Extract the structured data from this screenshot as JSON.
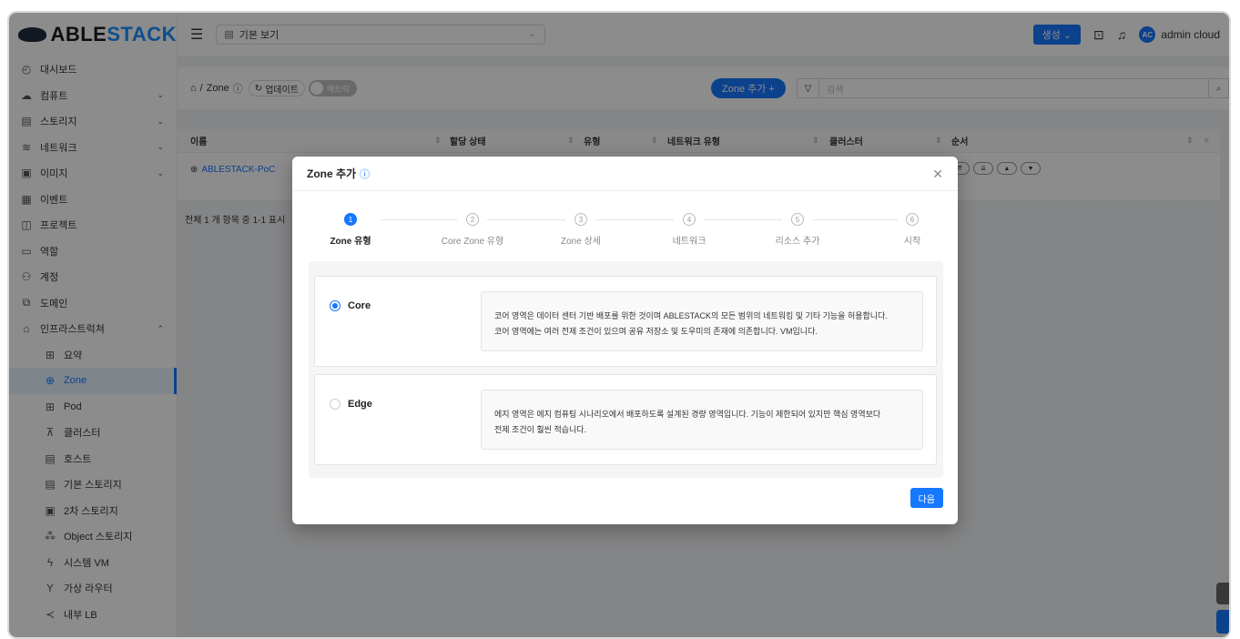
{
  "app": {
    "logo_text_a": "ABLE",
    "logo_text_b": "STACK",
    "accent": "#1677ff"
  },
  "sidebar": {
    "items": [
      {
        "label": "대시보드",
        "icon": "dashboard-icon"
      },
      {
        "label": "컴퓨트",
        "icon": "cloud-icon",
        "expandable": true
      },
      {
        "label": "스토리지",
        "icon": "storage-icon",
        "expandable": true
      },
      {
        "label": "네트워크",
        "icon": "wifi-icon",
        "expandable": true
      },
      {
        "label": "이미지",
        "icon": "image-icon",
        "expandable": true
      },
      {
        "label": "이벤트",
        "icon": "calendar-icon"
      },
      {
        "label": "프로젝트",
        "icon": "project-icon"
      },
      {
        "label": "역할",
        "icon": "idcard-icon"
      },
      {
        "label": "계정",
        "icon": "team-icon"
      },
      {
        "label": "도메인",
        "icon": "domain-icon"
      },
      {
        "label": "인프라스트럭쳐",
        "icon": "bank-icon",
        "expanded": true
      }
    ],
    "sub_items": [
      {
        "label": "요약",
        "icon": "summary-icon"
      },
      {
        "label": "Zone",
        "icon": "globe-icon",
        "active": true
      },
      {
        "label": "Pod",
        "icon": "appstore-icon"
      },
      {
        "label": "클러스터",
        "icon": "cluster-icon"
      },
      {
        "label": "호스트",
        "icon": "host-icon"
      },
      {
        "label": "기본 스토리지",
        "icon": "database-icon"
      },
      {
        "label": "2차 스토리지",
        "icon": "image-icon"
      },
      {
        "label": "Object 스토리지",
        "icon": "object-icon"
      },
      {
        "label": "시스템 VM",
        "icon": "thunder-icon"
      },
      {
        "label": "가상 라우터",
        "icon": "fork-icon"
      },
      {
        "label": "내부 LB",
        "icon": "share-icon"
      }
    ]
  },
  "header": {
    "view_select": "기본 보기",
    "create_label": "생성",
    "user_initials": "AC",
    "user_name": "admin cloud"
  },
  "toolbar": {
    "breadcrumb_sep": "/",
    "breadcrumb_page": "Zone",
    "refresh_label": "업데이트",
    "metrics_label": "메트릭",
    "zone_add_label": "Zone 추가 +",
    "search_placeholder": "검색"
  },
  "table": {
    "columns": [
      "이름",
      "할당 상태",
      "유형",
      "네트워크 유형",
      "클러스터",
      "순서"
    ],
    "rows": [
      {
        "name": "ABLESTACK-PoC"
      }
    ],
    "total_text": "전체 1 개 항목 중 1-1 표시"
  },
  "modal": {
    "title": "Zone 추가",
    "steps": [
      {
        "num": "1",
        "label": "Zone 유형",
        "current": true
      },
      {
        "num": "2",
        "label": "Core Zone 유형"
      },
      {
        "num": "3",
        "label": "Zone 상세"
      },
      {
        "num": "4",
        "label": "네트워크"
      },
      {
        "num": "5",
        "label": "리소스 추가"
      },
      {
        "num": "6",
        "label": "시작"
      }
    ],
    "options": [
      {
        "label": "Core",
        "selected": true,
        "desc_line1": "코어 영역은 데이터 센터 기반 배포를 위한 것이며 ABLESTACK의 모든 범위의 네트워킹 및 기타 기능을 허용합니다.",
        "desc_line2": "코어 영역에는 여러 전제 조건이 있으며 공유 저장소 및 도우미의 존재에 의존합니다. VM입니다."
      },
      {
        "label": "Edge",
        "selected": false,
        "desc_line1": "에지 영역은 에지 컴퓨팅 시나리오에서 배포하도록 설계된 경량 영역입니다. 기능이 제한되어 있지만 핵심 영역보다",
        "desc_line2": "전제 조건이 훨씬 적습니다."
      }
    ],
    "next_label": "다음"
  }
}
